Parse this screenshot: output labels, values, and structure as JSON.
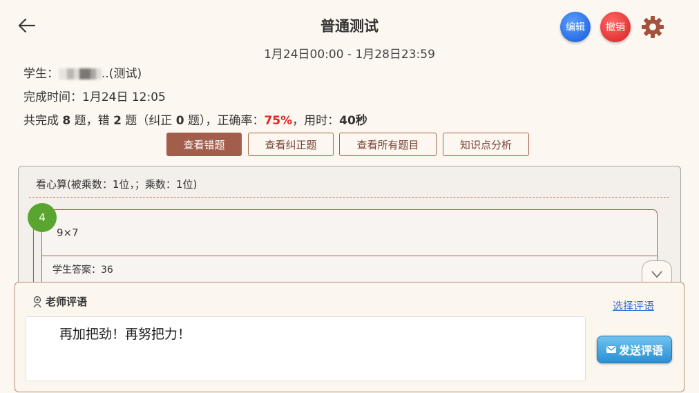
{
  "header": {
    "title": "普通测试",
    "time_range": "1月24日00:00 - 1月28日23:59",
    "edit_label": "编辑",
    "undo_label": "撤销"
  },
  "info": {
    "student_label": "学生：",
    "student_suffix": "..(测试)",
    "completion_time": "完成时间：1月24日 12:05",
    "summary": {
      "part1": "共完成 ",
      "total": "8",
      "part2": " 题，错 ",
      "wrong": "2",
      "part3": " 题（纠正 ",
      "corrected": "0",
      "part4": " 题），正确率：",
      "accuracy": "75%",
      "part5": "，用时：",
      "time_used": "40秒"
    }
  },
  "tabs": [
    {
      "label": "查看错题",
      "active": true
    },
    {
      "label": "查看纠正题",
      "active": false
    },
    {
      "label": "查看所有题目",
      "active": false
    },
    {
      "label": "知识点分析",
      "active": false
    }
  ],
  "section": {
    "title": "看心算(被乘数：1位，；乘数：1位)"
  },
  "question": {
    "number": "4",
    "text": "9×7",
    "answer": "学生答案：36"
  },
  "comment": {
    "title": "老师评语",
    "choose_label": "选择评语",
    "text": "再加把劲！再努把力！",
    "send_label": "发送评语"
  },
  "colors": {
    "accent": "#a35d4b",
    "accuracy": "#e52222",
    "badge": "#5aa52f",
    "edit": "#1657d8",
    "undo": "#d81d1d"
  }
}
